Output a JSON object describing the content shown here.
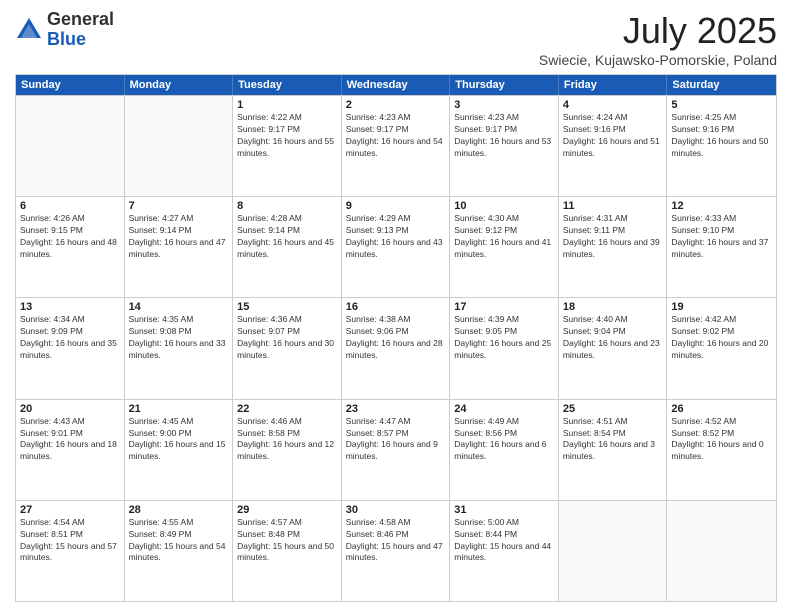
{
  "header": {
    "logo": {
      "general": "General",
      "blue": "Blue"
    },
    "month": "July 2025",
    "location": "Swiecie, Kujawsko-Pomorskie, Poland"
  },
  "weekdays": [
    "Sunday",
    "Monday",
    "Tuesday",
    "Wednesday",
    "Thursday",
    "Friday",
    "Saturday"
  ],
  "rows": [
    [
      {
        "day": "",
        "sunrise": "",
        "sunset": "",
        "daylight": "",
        "empty": true
      },
      {
        "day": "",
        "sunrise": "",
        "sunset": "",
        "daylight": "",
        "empty": true
      },
      {
        "day": "1",
        "sunrise": "Sunrise: 4:22 AM",
        "sunset": "Sunset: 9:17 PM",
        "daylight": "Daylight: 16 hours and 55 minutes."
      },
      {
        "day": "2",
        "sunrise": "Sunrise: 4:23 AM",
        "sunset": "Sunset: 9:17 PM",
        "daylight": "Daylight: 16 hours and 54 minutes."
      },
      {
        "day": "3",
        "sunrise": "Sunrise: 4:23 AM",
        "sunset": "Sunset: 9:17 PM",
        "daylight": "Daylight: 16 hours and 53 minutes."
      },
      {
        "day": "4",
        "sunrise": "Sunrise: 4:24 AM",
        "sunset": "Sunset: 9:16 PM",
        "daylight": "Daylight: 16 hours and 51 minutes."
      },
      {
        "day": "5",
        "sunrise": "Sunrise: 4:25 AM",
        "sunset": "Sunset: 9:16 PM",
        "daylight": "Daylight: 16 hours and 50 minutes."
      }
    ],
    [
      {
        "day": "6",
        "sunrise": "Sunrise: 4:26 AM",
        "sunset": "Sunset: 9:15 PM",
        "daylight": "Daylight: 16 hours and 48 minutes."
      },
      {
        "day": "7",
        "sunrise": "Sunrise: 4:27 AM",
        "sunset": "Sunset: 9:14 PM",
        "daylight": "Daylight: 16 hours and 47 minutes."
      },
      {
        "day": "8",
        "sunrise": "Sunrise: 4:28 AM",
        "sunset": "Sunset: 9:14 PM",
        "daylight": "Daylight: 16 hours and 45 minutes."
      },
      {
        "day": "9",
        "sunrise": "Sunrise: 4:29 AM",
        "sunset": "Sunset: 9:13 PM",
        "daylight": "Daylight: 16 hours and 43 minutes."
      },
      {
        "day": "10",
        "sunrise": "Sunrise: 4:30 AM",
        "sunset": "Sunset: 9:12 PM",
        "daylight": "Daylight: 16 hours and 41 minutes."
      },
      {
        "day": "11",
        "sunrise": "Sunrise: 4:31 AM",
        "sunset": "Sunset: 9:11 PM",
        "daylight": "Daylight: 16 hours and 39 minutes."
      },
      {
        "day": "12",
        "sunrise": "Sunrise: 4:33 AM",
        "sunset": "Sunset: 9:10 PM",
        "daylight": "Daylight: 16 hours and 37 minutes."
      }
    ],
    [
      {
        "day": "13",
        "sunrise": "Sunrise: 4:34 AM",
        "sunset": "Sunset: 9:09 PM",
        "daylight": "Daylight: 16 hours and 35 minutes."
      },
      {
        "day": "14",
        "sunrise": "Sunrise: 4:35 AM",
        "sunset": "Sunset: 9:08 PM",
        "daylight": "Daylight: 16 hours and 33 minutes."
      },
      {
        "day": "15",
        "sunrise": "Sunrise: 4:36 AM",
        "sunset": "Sunset: 9:07 PM",
        "daylight": "Daylight: 16 hours and 30 minutes."
      },
      {
        "day": "16",
        "sunrise": "Sunrise: 4:38 AM",
        "sunset": "Sunset: 9:06 PM",
        "daylight": "Daylight: 16 hours and 28 minutes."
      },
      {
        "day": "17",
        "sunrise": "Sunrise: 4:39 AM",
        "sunset": "Sunset: 9:05 PM",
        "daylight": "Daylight: 16 hours and 25 minutes."
      },
      {
        "day": "18",
        "sunrise": "Sunrise: 4:40 AM",
        "sunset": "Sunset: 9:04 PM",
        "daylight": "Daylight: 16 hours and 23 minutes."
      },
      {
        "day": "19",
        "sunrise": "Sunrise: 4:42 AM",
        "sunset": "Sunset: 9:02 PM",
        "daylight": "Daylight: 16 hours and 20 minutes."
      }
    ],
    [
      {
        "day": "20",
        "sunrise": "Sunrise: 4:43 AM",
        "sunset": "Sunset: 9:01 PM",
        "daylight": "Daylight: 16 hours and 18 minutes."
      },
      {
        "day": "21",
        "sunrise": "Sunrise: 4:45 AM",
        "sunset": "Sunset: 9:00 PM",
        "daylight": "Daylight: 16 hours and 15 minutes."
      },
      {
        "day": "22",
        "sunrise": "Sunrise: 4:46 AM",
        "sunset": "Sunset: 8:58 PM",
        "daylight": "Daylight: 16 hours and 12 minutes."
      },
      {
        "day": "23",
        "sunrise": "Sunrise: 4:47 AM",
        "sunset": "Sunset: 8:57 PM",
        "daylight": "Daylight: 16 hours and 9 minutes."
      },
      {
        "day": "24",
        "sunrise": "Sunrise: 4:49 AM",
        "sunset": "Sunset: 8:56 PM",
        "daylight": "Daylight: 16 hours and 6 minutes."
      },
      {
        "day": "25",
        "sunrise": "Sunrise: 4:51 AM",
        "sunset": "Sunset: 8:54 PM",
        "daylight": "Daylight: 16 hours and 3 minutes."
      },
      {
        "day": "26",
        "sunrise": "Sunrise: 4:52 AM",
        "sunset": "Sunset: 8:52 PM",
        "daylight": "Daylight: 16 hours and 0 minutes."
      }
    ],
    [
      {
        "day": "27",
        "sunrise": "Sunrise: 4:54 AM",
        "sunset": "Sunset: 8:51 PM",
        "daylight": "Daylight: 15 hours and 57 minutes."
      },
      {
        "day": "28",
        "sunrise": "Sunrise: 4:55 AM",
        "sunset": "Sunset: 8:49 PM",
        "daylight": "Daylight: 15 hours and 54 minutes."
      },
      {
        "day": "29",
        "sunrise": "Sunrise: 4:57 AM",
        "sunset": "Sunset: 8:48 PM",
        "daylight": "Daylight: 15 hours and 50 minutes."
      },
      {
        "day": "30",
        "sunrise": "Sunrise: 4:58 AM",
        "sunset": "Sunset: 8:46 PM",
        "daylight": "Daylight: 15 hours and 47 minutes."
      },
      {
        "day": "31",
        "sunrise": "Sunrise: 5:00 AM",
        "sunset": "Sunset: 8:44 PM",
        "daylight": "Daylight: 15 hours and 44 minutes."
      },
      {
        "day": "",
        "sunrise": "",
        "sunset": "",
        "daylight": "",
        "empty": true
      },
      {
        "day": "",
        "sunrise": "",
        "sunset": "",
        "daylight": "",
        "empty": true
      }
    ]
  ]
}
